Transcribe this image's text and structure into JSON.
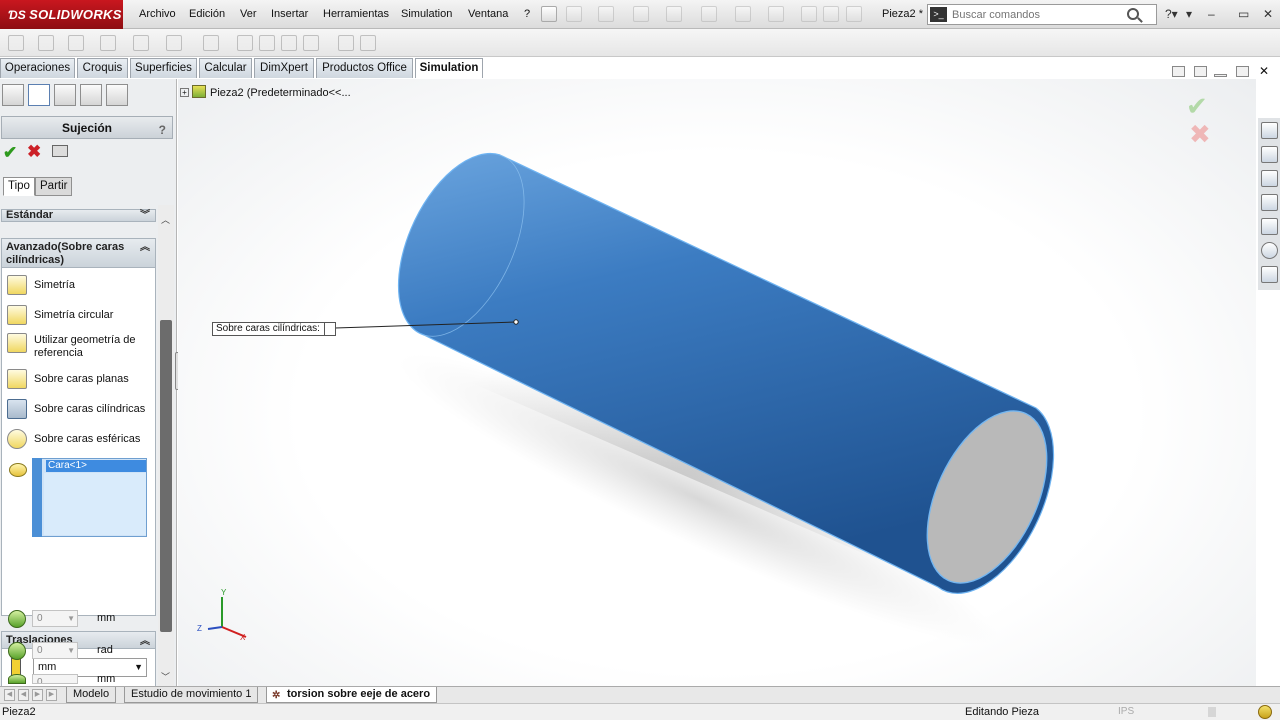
{
  "app": {
    "logo_text": "SOLIDWORKS",
    "doc_name": "Pieza2 *"
  },
  "menu": [
    "Archivo",
    "Edición",
    "Ver",
    "Insertar",
    "Herramientas",
    "Simulation",
    "Ventana",
    "?"
  ],
  "search": {
    "placeholder": "Buscar comandos"
  },
  "command_tabs": [
    "Operaciones",
    "Croquis",
    "Superficies",
    "Calcular",
    "DimXpert",
    "Productos Office",
    "Simulation"
  ],
  "active_command_tab": "Simulation",
  "property_manager": {
    "title": "Sujeción",
    "help": "?",
    "subtabs": [
      "Tipo",
      "Partir"
    ],
    "standard_group": "Estándar",
    "advanced_group": "Avanzado(Sobre caras cilíndricas)",
    "options": [
      "Simetría",
      "Simetría circular",
      "Utilizar geometría de referencia",
      "Sobre caras planas",
      "Sobre caras cilíndricas",
      "Sobre caras esféricas"
    ],
    "selected_option": "Sobre caras cilíndricas",
    "face_selection": "Cara<1>",
    "translations_group": "Traslaciones",
    "unit": "mm",
    "rows": [
      {
        "value": "0",
        "unit": "mm"
      },
      {
        "value": "0",
        "unit": "rad"
      },
      {
        "value": "0",
        "unit": "mm"
      }
    ]
  },
  "tree": {
    "label": "Pieza2  (Predeterminado<<..."
  },
  "graphics": {
    "callout": "Sobre caras cilíndricas:",
    "triad": {
      "x": "X",
      "y": "Y",
      "z": "Z"
    },
    "cylinder_color": "#3e7fc4",
    "end_face_color": "#b8b8b8"
  },
  "bottom_tabs": [
    "Modelo",
    "Estudio de movimiento 1",
    "torsion sobre eeje de acero"
  ],
  "active_bottom_tab": "torsion sobre eeje de acero",
  "status": {
    "left": "Pieza2",
    "mode": "Editando Pieza",
    "units": "IPS"
  }
}
